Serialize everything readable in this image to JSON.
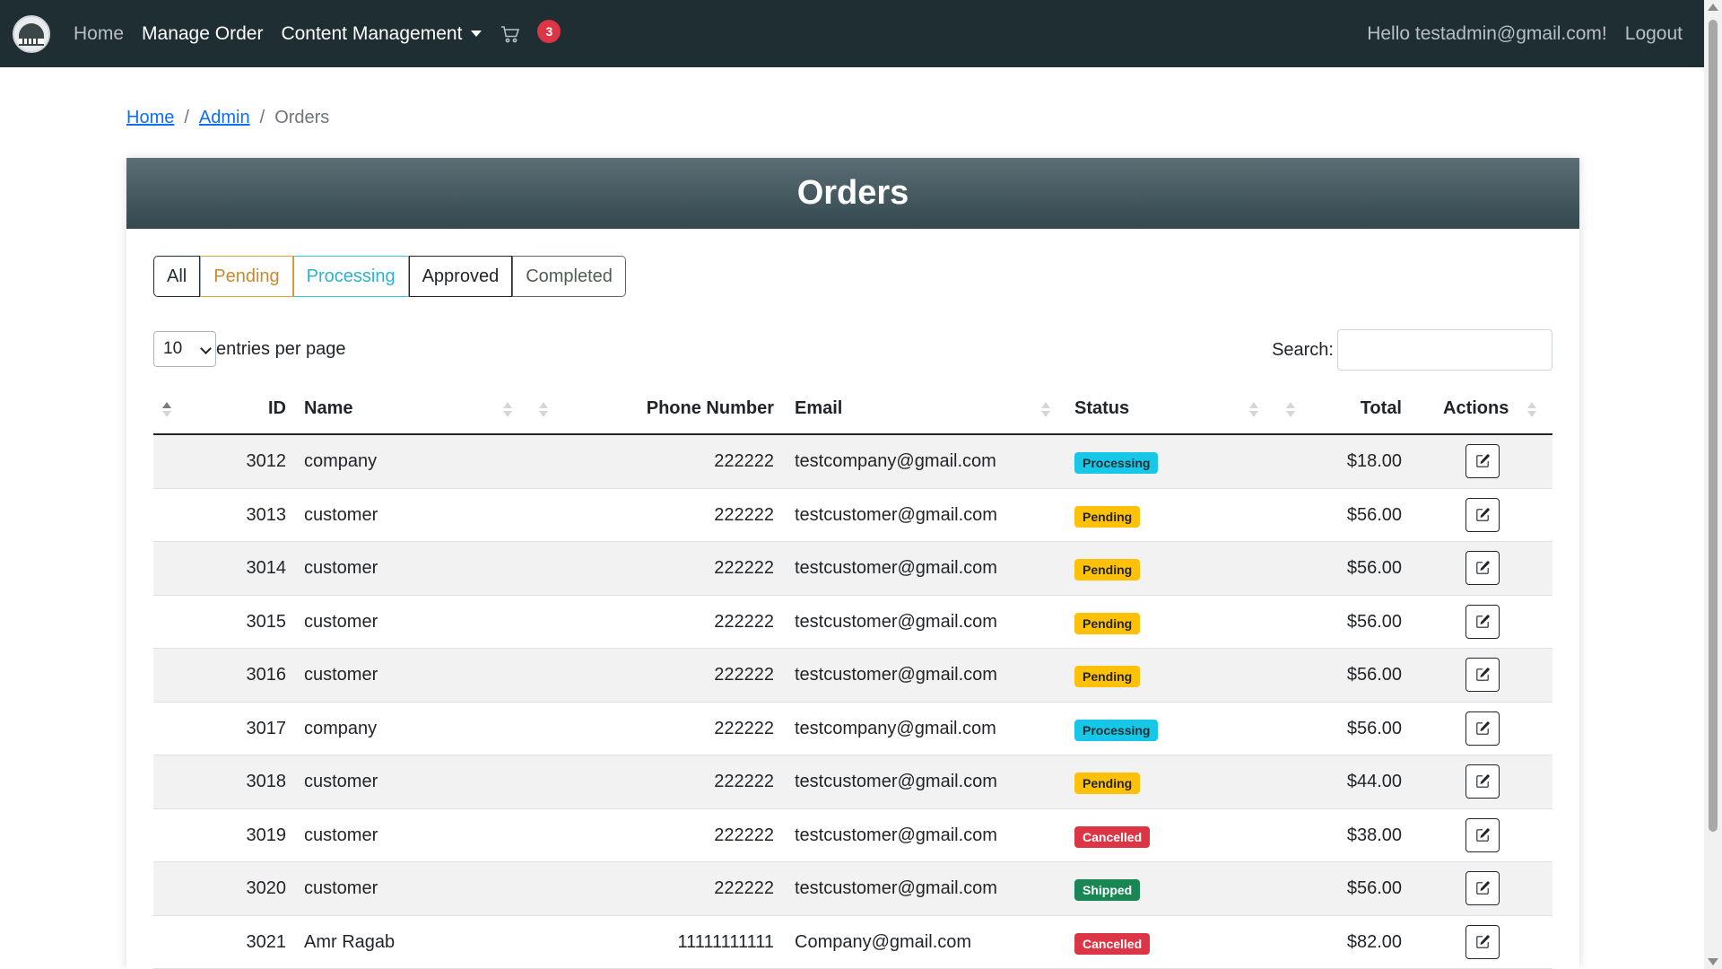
{
  "nav": {
    "home": "Home",
    "manage_order": "Manage Order",
    "content_management": "Content Management",
    "cart_count": "3",
    "greeting": "Hello testadmin@gmail.com!",
    "logout": "Logout"
  },
  "breadcrumb": {
    "home": "Home",
    "admin": "Admin",
    "current": "Orders",
    "separator": "/"
  },
  "page_title": "Orders",
  "filters": {
    "all": "All",
    "pending": "Pending",
    "processing": "Processing",
    "approved": "Approved",
    "completed": "Completed"
  },
  "entries": {
    "value": "10",
    "label": "entries per page"
  },
  "search": {
    "label": "Search:"
  },
  "table": {
    "headers": {
      "id": "ID",
      "name": "Name",
      "phone": "Phone Number",
      "email": "Email",
      "status": "Status",
      "total": "Total",
      "actions": "Actions"
    },
    "rows": [
      {
        "id": "3012",
        "name": "company",
        "phone": "222222",
        "email": "testcompany@gmail.com",
        "status": "Processing",
        "total": "$18.00"
      },
      {
        "id": "3013",
        "name": "customer",
        "phone": "222222",
        "email": "testcustomer@gmail.com",
        "status": "Pending",
        "total": "$56.00"
      },
      {
        "id": "3014",
        "name": "customer",
        "phone": "222222",
        "email": "testcustomer@gmail.com",
        "status": "Pending",
        "total": "$56.00"
      },
      {
        "id": "3015",
        "name": "customer",
        "phone": "222222",
        "email": "testcustomer@gmail.com",
        "status": "Pending",
        "total": "$56.00"
      },
      {
        "id": "3016",
        "name": "customer",
        "phone": "222222",
        "email": "testcustomer@gmail.com",
        "status": "Pending",
        "total": "$56.00"
      },
      {
        "id": "3017",
        "name": "company",
        "phone": "222222",
        "email": "testcompany@gmail.com",
        "status": "Processing",
        "total": "$56.00"
      },
      {
        "id": "3018",
        "name": "customer",
        "phone": "222222",
        "email": "testcustomer@gmail.com",
        "status": "Pending",
        "total": "$44.00"
      },
      {
        "id": "3019",
        "name": "customer",
        "phone": "222222",
        "email": "testcustomer@gmail.com",
        "status": "Cancelled",
        "total": "$38.00"
      },
      {
        "id": "3020",
        "name": "customer",
        "phone": "222222",
        "email": "testcustomer@gmail.com",
        "status": "Shipped",
        "total": "$56.00"
      },
      {
        "id": "3021",
        "name": "Amr Ragab",
        "phone": "11111111111",
        "email": "Company@gmail.com",
        "status": "Cancelled",
        "total": "$82.00"
      }
    ]
  },
  "colors": {
    "navbar": "#1f2e32",
    "processing": "#17c7e8",
    "pending": "#ffc107",
    "cancelled": "#dc3545",
    "shipped": "#198754",
    "badge": "#dc3545"
  },
  "icons": {
    "logo": "building-logo-icon",
    "cart": "cart-icon",
    "edit": "edit-icon",
    "sort": "sort-arrows-icon"
  }
}
